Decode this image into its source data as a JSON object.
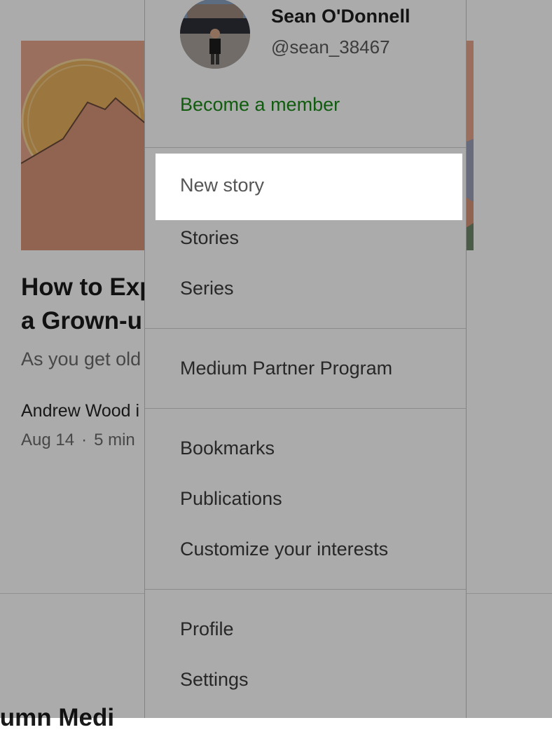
{
  "background_article": {
    "title_line1": "How to Exp",
    "title_line2": "a Grown-u",
    "subtitle": "As you get old",
    "author": "Andrew Wood i",
    "date": "Aug 14",
    "read_time": "5 min",
    "next_title": "lumn Medi"
  },
  "user": {
    "name": "Sean O'Donnell",
    "handle": "@sean_38467"
  },
  "membership": {
    "label": "Become a member",
    "color": "#1a8917"
  },
  "menu": {
    "new_story": "New story",
    "stories": "Stories",
    "series": "Series",
    "partner_program": "Medium Partner Program",
    "bookmarks": "Bookmarks",
    "publications": "Publications",
    "customize": "Customize your interests",
    "profile": "Profile",
    "settings": "Settings"
  },
  "colors": {
    "overlay": "rgba(0,0,0,0.33)",
    "accent": "#1a8917"
  }
}
